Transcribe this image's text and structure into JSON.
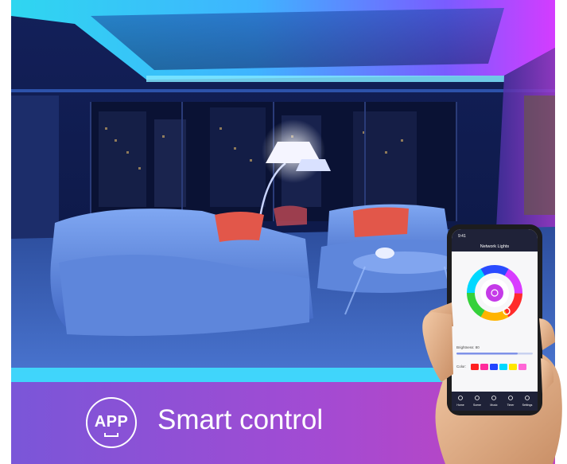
{
  "banner": {
    "badge_label": "APP",
    "headline": "Smart control"
  },
  "phone_app": {
    "status_time": "9:41",
    "title": "Network Lights",
    "brightness_label": "Brightness: 80",
    "color_label": "Color:",
    "nav_items": [
      "Home",
      "Scene",
      "Music",
      "Timer",
      "Settings"
    ],
    "swatch_colors": [
      "#ff2020",
      "#ff2b9c",
      "#2244ff",
      "#00d8ff",
      "#ffe600",
      "#ff66d6"
    ]
  },
  "colors": {
    "banner_left": "#7a56d8",
    "banner_right": "#c243bf",
    "room_accent_cyan": "#3fe0ff",
    "room_accent_magenta": "#d63fff"
  }
}
